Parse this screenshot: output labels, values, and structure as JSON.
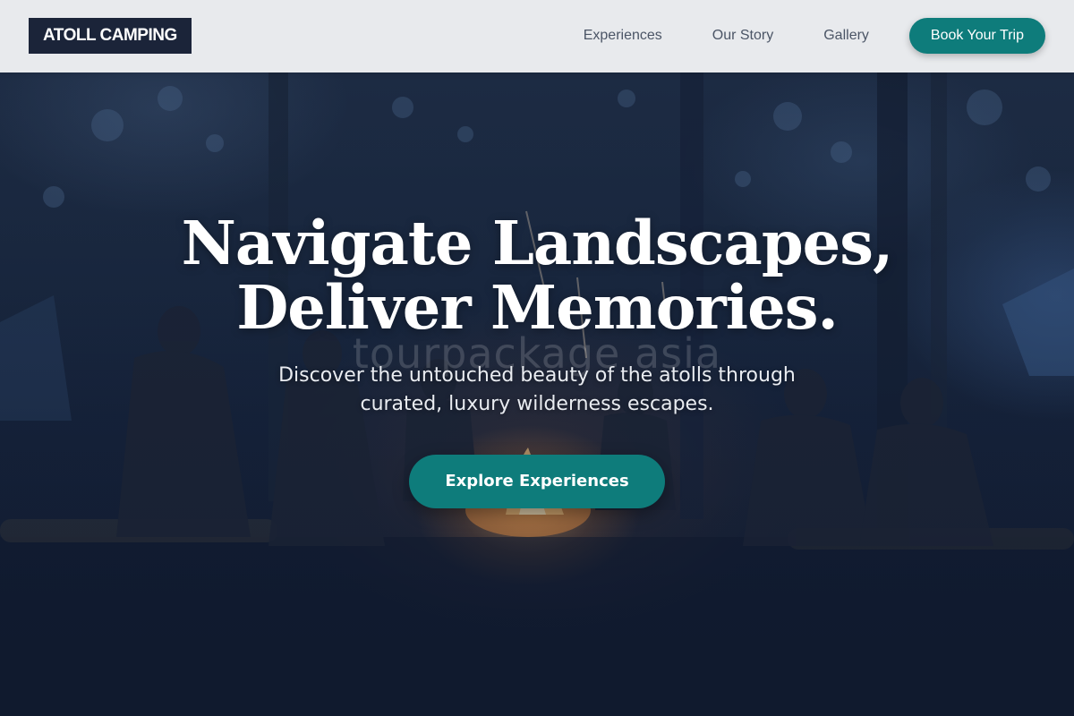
{
  "brand": {
    "logo_text": "ATOLL CAMPING"
  },
  "nav": {
    "links": [
      {
        "label": "Experiences"
      },
      {
        "label": "Our Story"
      },
      {
        "label": "Gallery"
      }
    ],
    "cta_label": "Book Your Trip"
  },
  "hero": {
    "title_line1": "Navigate Landscapes,",
    "title_line2": "Deliver Memories.",
    "subtitle": "Discover the untouched beauty of the atolls through curated, luxury wilderness escapes.",
    "button_label": "Explore Experiences",
    "watermark": "tourpackage asia"
  },
  "colors": {
    "accent": "#0e7c7b",
    "logo_bg": "#1b2439",
    "navbar_bg": "#e8eaed",
    "nav_text": "#4b5566"
  }
}
